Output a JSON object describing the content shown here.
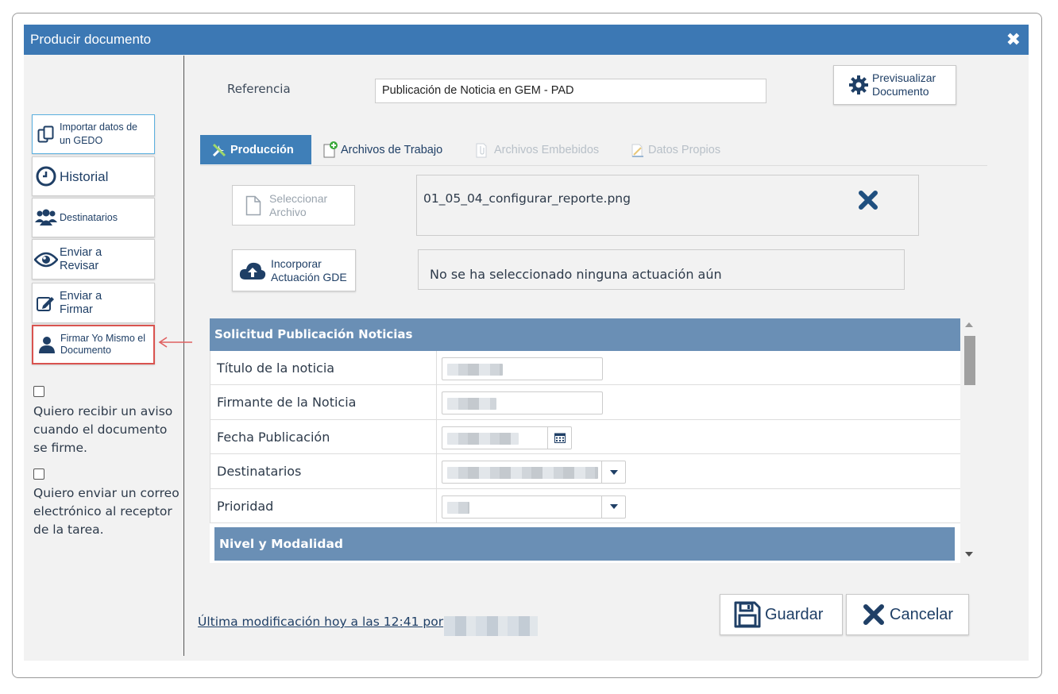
{
  "dialog": {
    "title": "Producir documento",
    "close_icon": "close-icon"
  },
  "sidebar": {
    "buttons": [
      {
        "icon": "copy-document-icon",
        "label": "Importar datos de un GEDO"
      },
      {
        "icon": "clock-icon",
        "label": "Historial"
      },
      {
        "icon": "users-icon",
        "label": "Destinatarios"
      },
      {
        "icon": "eye-icon",
        "label": "Enviar a Revisar"
      },
      {
        "icon": "edit-icon",
        "label": "Enviar a Firmar"
      },
      {
        "icon": "user-icon",
        "label": "Firmar Yo Mismo el Documento"
      }
    ],
    "checkboxes": [
      {
        "label": "Quiero recibir un aviso cuando el documento se firme.",
        "checked": false
      },
      {
        "label": "Quiero enviar un correo electrónico al receptor de la tarea.",
        "checked": false
      }
    ]
  },
  "header": {
    "reference_label": "Referencia",
    "reference_value": "Publicación de Noticia en GEM - PAD",
    "preview_button": "Previsualizar Documento"
  },
  "tabs": [
    {
      "label": "Producción",
      "active": true,
      "icon": "wrench-icon"
    },
    {
      "label": "Archivos de Trabajo",
      "active": false,
      "icon": "add-file-icon"
    },
    {
      "label": "Archivos Embebidos",
      "active": false,
      "disabled": true,
      "icon": "attachment-icon"
    },
    {
      "label": "Datos Propios",
      "active": false,
      "disabled": true,
      "icon": "document-edit-icon"
    }
  ],
  "production": {
    "select_file_button": "Seleccionar Archivo",
    "selected_file": "01_05_04_configurar_reporte.png",
    "incorporate_button": "Incorporar Actuación GDE",
    "no_actuacion_text": "No se ha seleccionado ninguna actuación aún"
  },
  "form": {
    "section_title": "Solicitud Publicación Noticias",
    "rows": [
      {
        "label": "Título de la noticia",
        "type": "text"
      },
      {
        "label": "Firmante de la Noticia",
        "type": "text"
      },
      {
        "label": "Fecha Publicación",
        "type": "date"
      },
      {
        "label": "Destinatarios",
        "type": "select"
      },
      {
        "label": "Prioridad",
        "type": "select"
      }
    ],
    "section2_title": "Nivel y Modalidad"
  },
  "footer": {
    "last_modified": "Última modificación hoy a las 12:41 por",
    "save_button": "Guardar",
    "cancel_button": "Cancelar"
  },
  "colors": {
    "titlebar": "#3c78b4",
    "active_tab": "#3f7fb8",
    "form_header": "#6a8fb5",
    "highlight_border": "#d9534f",
    "icon_blue": "#1f3f66"
  }
}
